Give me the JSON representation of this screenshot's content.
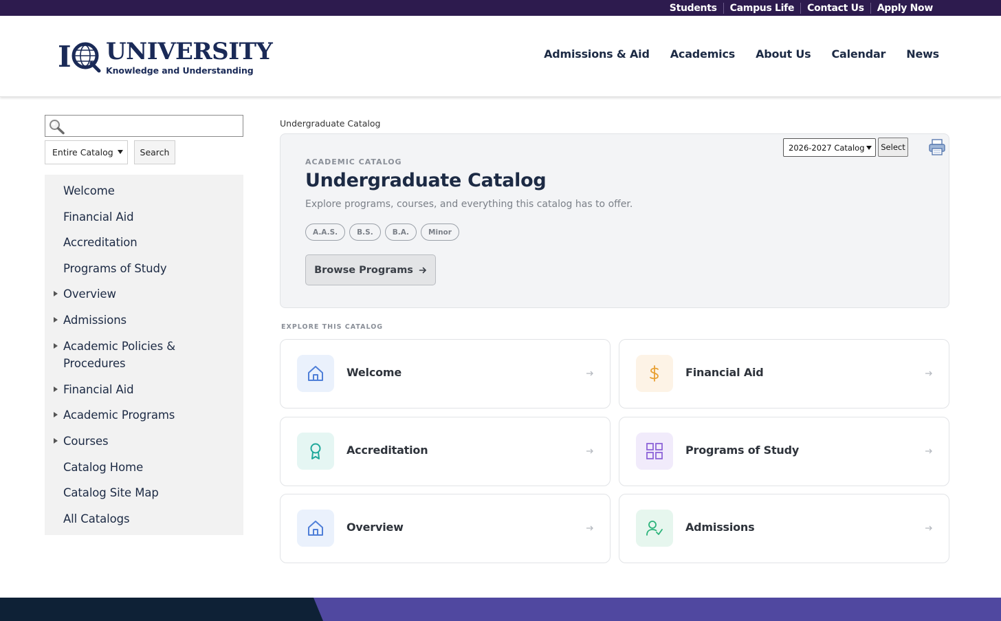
{
  "utility_nav": [
    "Students",
    "Campus Life",
    "Contact Us",
    "Apply Now"
  ],
  "logo": {
    "wordmark": "UNIVERSITY",
    "tagline": "Knowledge and Understanding"
  },
  "main_nav": [
    "Admissions & Aid",
    "Academics",
    "About Us",
    "Calendar",
    "News"
  ],
  "search": {
    "query": "",
    "scope": "Entire Catalog",
    "button_label": "Search"
  },
  "sidebar": {
    "items": [
      {
        "label": "Welcome",
        "expandable": false
      },
      {
        "label": "Financial Aid",
        "expandable": false
      },
      {
        "label": "Accreditation",
        "expandable": false
      },
      {
        "label": "Programs of Study",
        "expandable": false
      },
      {
        "label": "Overview",
        "expandable": true
      },
      {
        "label": "Admissions",
        "expandable": true
      },
      {
        "label": "Academic Policies & Procedures",
        "expandable": true
      },
      {
        "label": "Financial Aid",
        "expandable": true
      },
      {
        "label": "Academic Programs",
        "expandable": true
      },
      {
        "label": "Courses",
        "expandable": true
      },
      {
        "label": "Catalog Home",
        "expandable": false
      },
      {
        "label": "Catalog Site Map",
        "expandable": false
      },
      {
        "label": "All Catalogs",
        "expandable": false
      }
    ]
  },
  "breadcrumb": "Undergraduate Catalog",
  "catalog_picker": {
    "selected": "2026-2027 Catalog",
    "button_label": "Select"
  },
  "hero": {
    "eyebrow": "ACADEMIC CATALOG",
    "title": "Undergraduate Catalog",
    "subtitle": "Explore programs, courses, and everything this catalog has to offer.",
    "degree_tags": [
      "A.A.S.",
      "B.S.",
      "B.A.",
      "Minor"
    ],
    "cta_label": "Browse Programs"
  },
  "explore": {
    "section_label": "EXPLORE THIS CATALOG",
    "cards": [
      {
        "title": "Welcome",
        "icon": "home-icon",
        "color": "#4f7fd8",
        "bg": "#eaf1fc"
      },
      {
        "title": "Financial Aid",
        "icon": "dollar-icon",
        "color": "#e8a033",
        "bg": "#fdf3e6"
      },
      {
        "title": "Accreditation",
        "icon": "award-ribbon-icon",
        "color": "#1fa89a",
        "bg": "#e5f6f3"
      },
      {
        "title": "Programs of Study",
        "icon": "grid-icon",
        "color": "#8c63d8",
        "bg": "#f1ebfb"
      },
      {
        "title": "Overview",
        "icon": "home-icon",
        "color": "#4f7fd8",
        "bg": "#eaf1fc"
      },
      {
        "title": "Admissions",
        "icon": "user-check-icon",
        "color": "#2bb37a",
        "bg": "#e6f6ee"
      }
    ]
  },
  "colors": {
    "utility_bar": "#2d1b4e",
    "brand_navy": "#1a2a57",
    "footer_dark": "#0e2136",
    "footer_purple": "#5048a0"
  }
}
